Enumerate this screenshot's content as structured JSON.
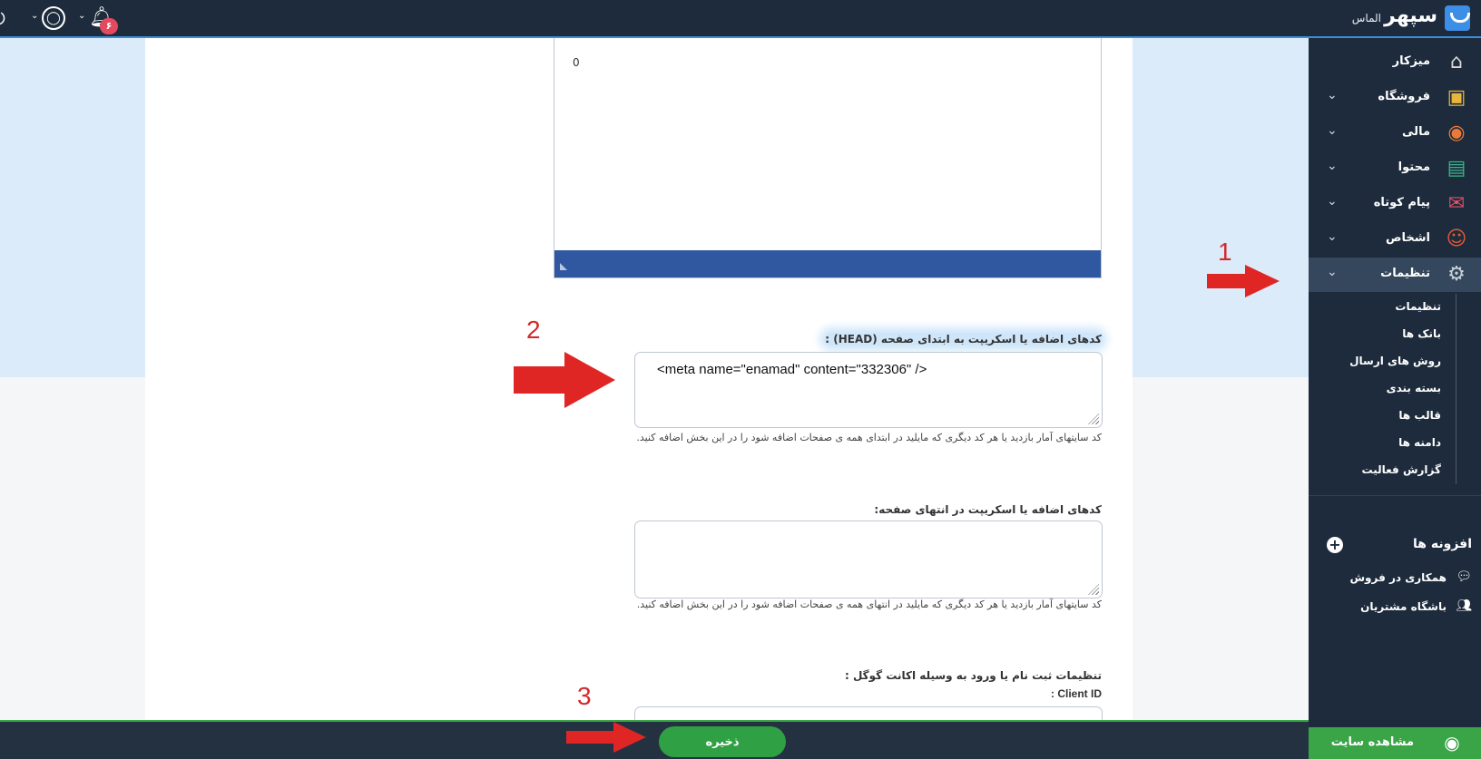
{
  "topbar": {
    "brand_name": "سپهر",
    "plan_name": "الماس",
    "notification_count": "۶"
  },
  "editor": {
    "value": "0"
  },
  "head_code": {
    "label": "کدهای اضافه یا اسکریپت به ابتدای صفحه (HEAD) :",
    "value": "<meta name=\"enamad\" content=\"332306\" />",
    "help": "کد سایتهای آمار بازدید یا هر کد دیگری که مایلید در ابتدای همه ی صفحات اضافه شود را در این بخش اضافه کنید."
  },
  "footer_code": {
    "label": "کدهای اضافه یا اسکریپت در انتهای صفحه:",
    "value": "",
    "help": "کد سایتهای آمار بازدید یا هر کد دیگری که مایلید در انتهای همه ی صفحات اضافه شود را در این بخش اضافه کنید."
  },
  "google_login": {
    "title": "تنظیمات ثبت نام یا ورود به وسیله اکانت گوگل :",
    "client_id_label": "Client ID :"
  },
  "markers": {
    "one": "1",
    "two": "2",
    "three": "3"
  },
  "sidebar": {
    "items": [
      {
        "label": "میزکار",
        "icon": "home-icon"
      },
      {
        "label": "فروشگاه",
        "icon": "shop-bag-icon"
      },
      {
        "label": "مالی",
        "icon": "coin-icon"
      },
      {
        "label": "محتوا",
        "icon": "document-icon"
      },
      {
        "label": "پیام کوتاه",
        "icon": "chat-icon"
      },
      {
        "label": "اشخاص",
        "icon": "person-icon"
      },
      {
        "label": "تنظیمات",
        "icon": "gear-icon"
      }
    ],
    "sub_items": [
      "تنظیمات",
      "بانک ها",
      "روش های ارسال",
      "بسته بندی",
      "قالب ها",
      "دامنه ها",
      "گزارش فعالیت"
    ],
    "addons_title": "افزونه ها",
    "addons": [
      {
        "label": "همکاری در فروش",
        "icon": "comments-icon"
      },
      {
        "label": "باشگاه مشتریان",
        "icon": "users-icon"
      }
    ],
    "view_site": "مشاهده سایت"
  },
  "bottombar": {
    "save_label": "ذخیره"
  },
  "colors": {
    "sidebar_bg": "#1d2b3c",
    "accent_blue": "#2f58a0",
    "save_green": "#2fa043",
    "annotation_red": "#e02525"
  }
}
